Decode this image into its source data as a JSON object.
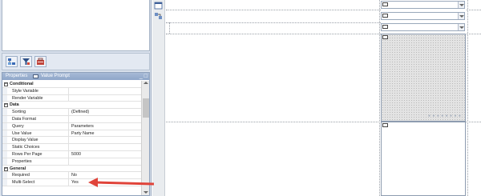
{
  "properties_panel": {
    "title": "Properties",
    "object_name": "Value Prompt",
    "title_buttons": "_ □",
    "rows": [
      {
        "type": "category",
        "name": "Conditional",
        "toggle": "−"
      },
      {
        "type": "prop",
        "name": "Style Variable",
        "value": ""
      },
      {
        "type": "prop",
        "name": "Render Variable",
        "value": ""
      },
      {
        "type": "category",
        "name": "Data",
        "toggle": "−"
      },
      {
        "type": "prop",
        "name": "Sorting",
        "value": "(Defined)"
      },
      {
        "type": "prop",
        "name": "Data Format",
        "value": ""
      },
      {
        "type": "prop",
        "name": "Query",
        "value": "Parameters"
      },
      {
        "type": "prop",
        "name": "Use Value",
        "value": "Party Name"
      },
      {
        "type": "prop",
        "name": "Display Value",
        "value": ""
      },
      {
        "type": "prop",
        "name": "Static Choices",
        "value": ""
      },
      {
        "type": "prop",
        "name": "Rows Per Page",
        "value": "5000"
      },
      {
        "type": "prop",
        "name": "Properties",
        "value": ""
      },
      {
        "type": "category",
        "name": "General",
        "toggle": "−"
      },
      {
        "type": "prop",
        "name": "Required",
        "value": "No"
      },
      {
        "type": "prop",
        "name": "Multi-Select",
        "value": "Yes"
      }
    ]
  },
  "toolbar": {
    "icons": [
      "hierarchy-icon",
      "filter-icon",
      "toolbox-icon"
    ]
  },
  "canvas": {
    "listbox_selection_links": "● ● ●  ● ● ● ● ●"
  },
  "annotation": {
    "arrow_color": "#e0443a"
  }
}
